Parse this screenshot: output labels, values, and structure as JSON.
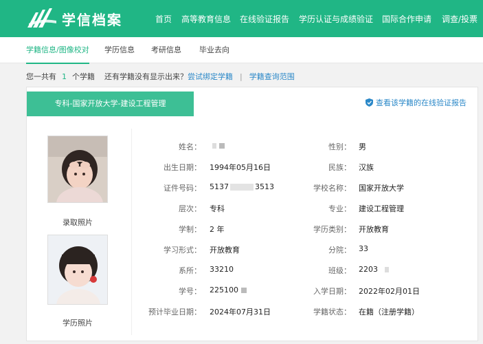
{
  "header": {
    "logo_text": "学信档案",
    "nav": [
      "首页",
      "高等教育信息",
      "在线验证报告",
      "学历认证与成绩验证",
      "国际合作申请",
      "调查/投票"
    ]
  },
  "subnav": {
    "items": [
      "学籍信息/图像校对",
      "学历信息",
      "考研信息",
      "毕业去向"
    ],
    "active_index": 0
  },
  "infobar": {
    "prefix": "您一共有",
    "count": "1",
    "suffix": "个学籍",
    "question": "还有学籍没有显示出来？",
    "bind_link": "尝试绑定学籍",
    "separator": "|",
    "range_link": "学籍查询范围"
  },
  "card": {
    "school_tab": "专科-国家开放大学-建设工程管理",
    "verify_link": "查看该学籍的在线验证报告",
    "photo_admission_caption": "录取照片",
    "photo_education_caption": "学历照片",
    "fields_left": [
      {
        "label": "姓名：",
        "value": ""
      },
      {
        "label": "出生日期：",
        "value": "1994年05月16日"
      },
      {
        "label": "证件号码：",
        "value": "5137",
        "value_tail": "3513"
      },
      {
        "label": "层次：",
        "value": "专科"
      },
      {
        "label": "学制：",
        "value": "2 年"
      },
      {
        "label": "学习形式：",
        "value": "开放教育"
      },
      {
        "label": "系所：",
        "value": "33210"
      },
      {
        "label": "学号：",
        "value": "225100"
      },
      {
        "label": "预计毕业日期：",
        "value": "2024年07月31日"
      }
    ],
    "fields_right": [
      {
        "label": "性别：",
        "value": "男"
      },
      {
        "label": "民族：",
        "value": "汉族"
      },
      {
        "label": "学校名称：",
        "value": "国家开放大学"
      },
      {
        "label": "专业：",
        "value": "建设工程管理"
      },
      {
        "label": "学历类别：",
        "value": "开放教育"
      },
      {
        "label": "分院：",
        "value": "33"
      },
      {
        "label": "班级：",
        "value": "2203"
      },
      {
        "label": "入学日期：",
        "value": "2022年02月01日"
      },
      {
        "label": "学籍状态：",
        "value": "在籍（注册学籍）"
      }
    ]
  },
  "colors": {
    "brand_green": "#20b685",
    "tab_green": "#3dbf95",
    "link_blue": "#2b88c8"
  }
}
